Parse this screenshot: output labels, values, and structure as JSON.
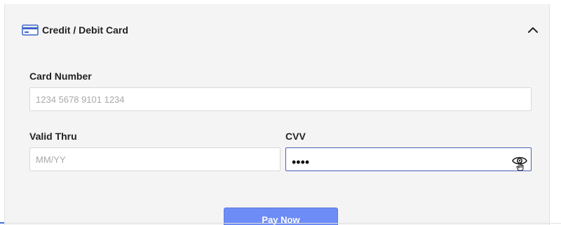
{
  "payment_method": {
    "title": "Credit / Debit Card",
    "icon": "credit-card-icon",
    "expanded": true,
    "collapse_icon": "chevron-up-icon"
  },
  "form": {
    "card_number": {
      "label": "Card Number",
      "placeholder": "1234 5678 9101 1234",
      "value": ""
    },
    "valid_thru": {
      "label": "Valid Thru",
      "placeholder": "MM/YY",
      "value": ""
    },
    "cvv": {
      "label": "CVV",
      "masked_value": "••••",
      "toggle_icon": "eye-icon"
    }
  },
  "actions": {
    "pay_label": "Pay Now"
  },
  "colors": {
    "panel_bg": "#f4f4f4",
    "focus_border": "#4a5fb8",
    "pay_button": "#6e8cf5"
  }
}
